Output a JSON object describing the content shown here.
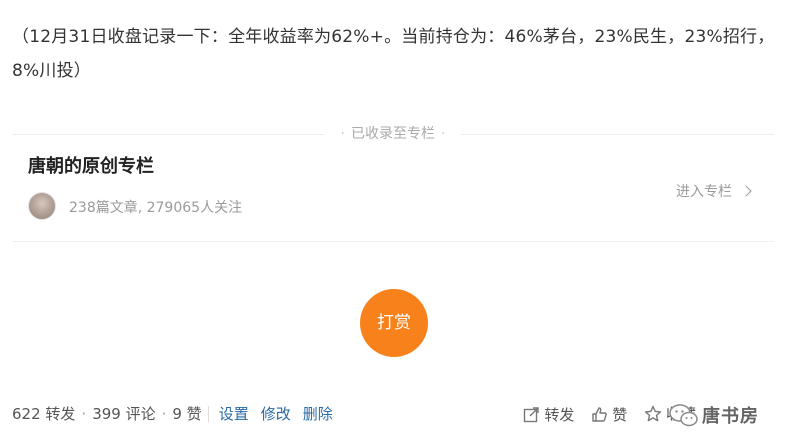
{
  "post": {
    "text": "（12月31日收盘记录一下：全年收益率为62%+。当前持仓为：46%茅台，23%民生，23%招行，8%川投）"
  },
  "divider": {
    "label": "已收录至专栏"
  },
  "column": {
    "title": "唐朝的原创专栏",
    "meta": "238篇文章, 279065人关注",
    "enter_label": "进入专栏"
  },
  "reward": {
    "label": "打赏"
  },
  "stats": {
    "reposts": "622 转发",
    "comments": "399 评论",
    "likes": "9 赞",
    "separator": "·"
  },
  "manage": {
    "settings": "设置",
    "edit": "修改",
    "delete": "删除"
  },
  "actions": {
    "repost": "转发",
    "like": "赞",
    "favorite": "收藏"
  },
  "watermark": {
    "text": "唐书房"
  },
  "colors": {
    "accent_orange": "#f7811a",
    "link_blue": "#2b6aa5",
    "muted_gray": "#9b9b9b"
  },
  "icons": {
    "repost": "share-icon",
    "like": "thumbs-up-icon",
    "favorite": "star-icon",
    "enter": "chevron-right-icon",
    "watermark": "wechat-logo-icon"
  }
}
